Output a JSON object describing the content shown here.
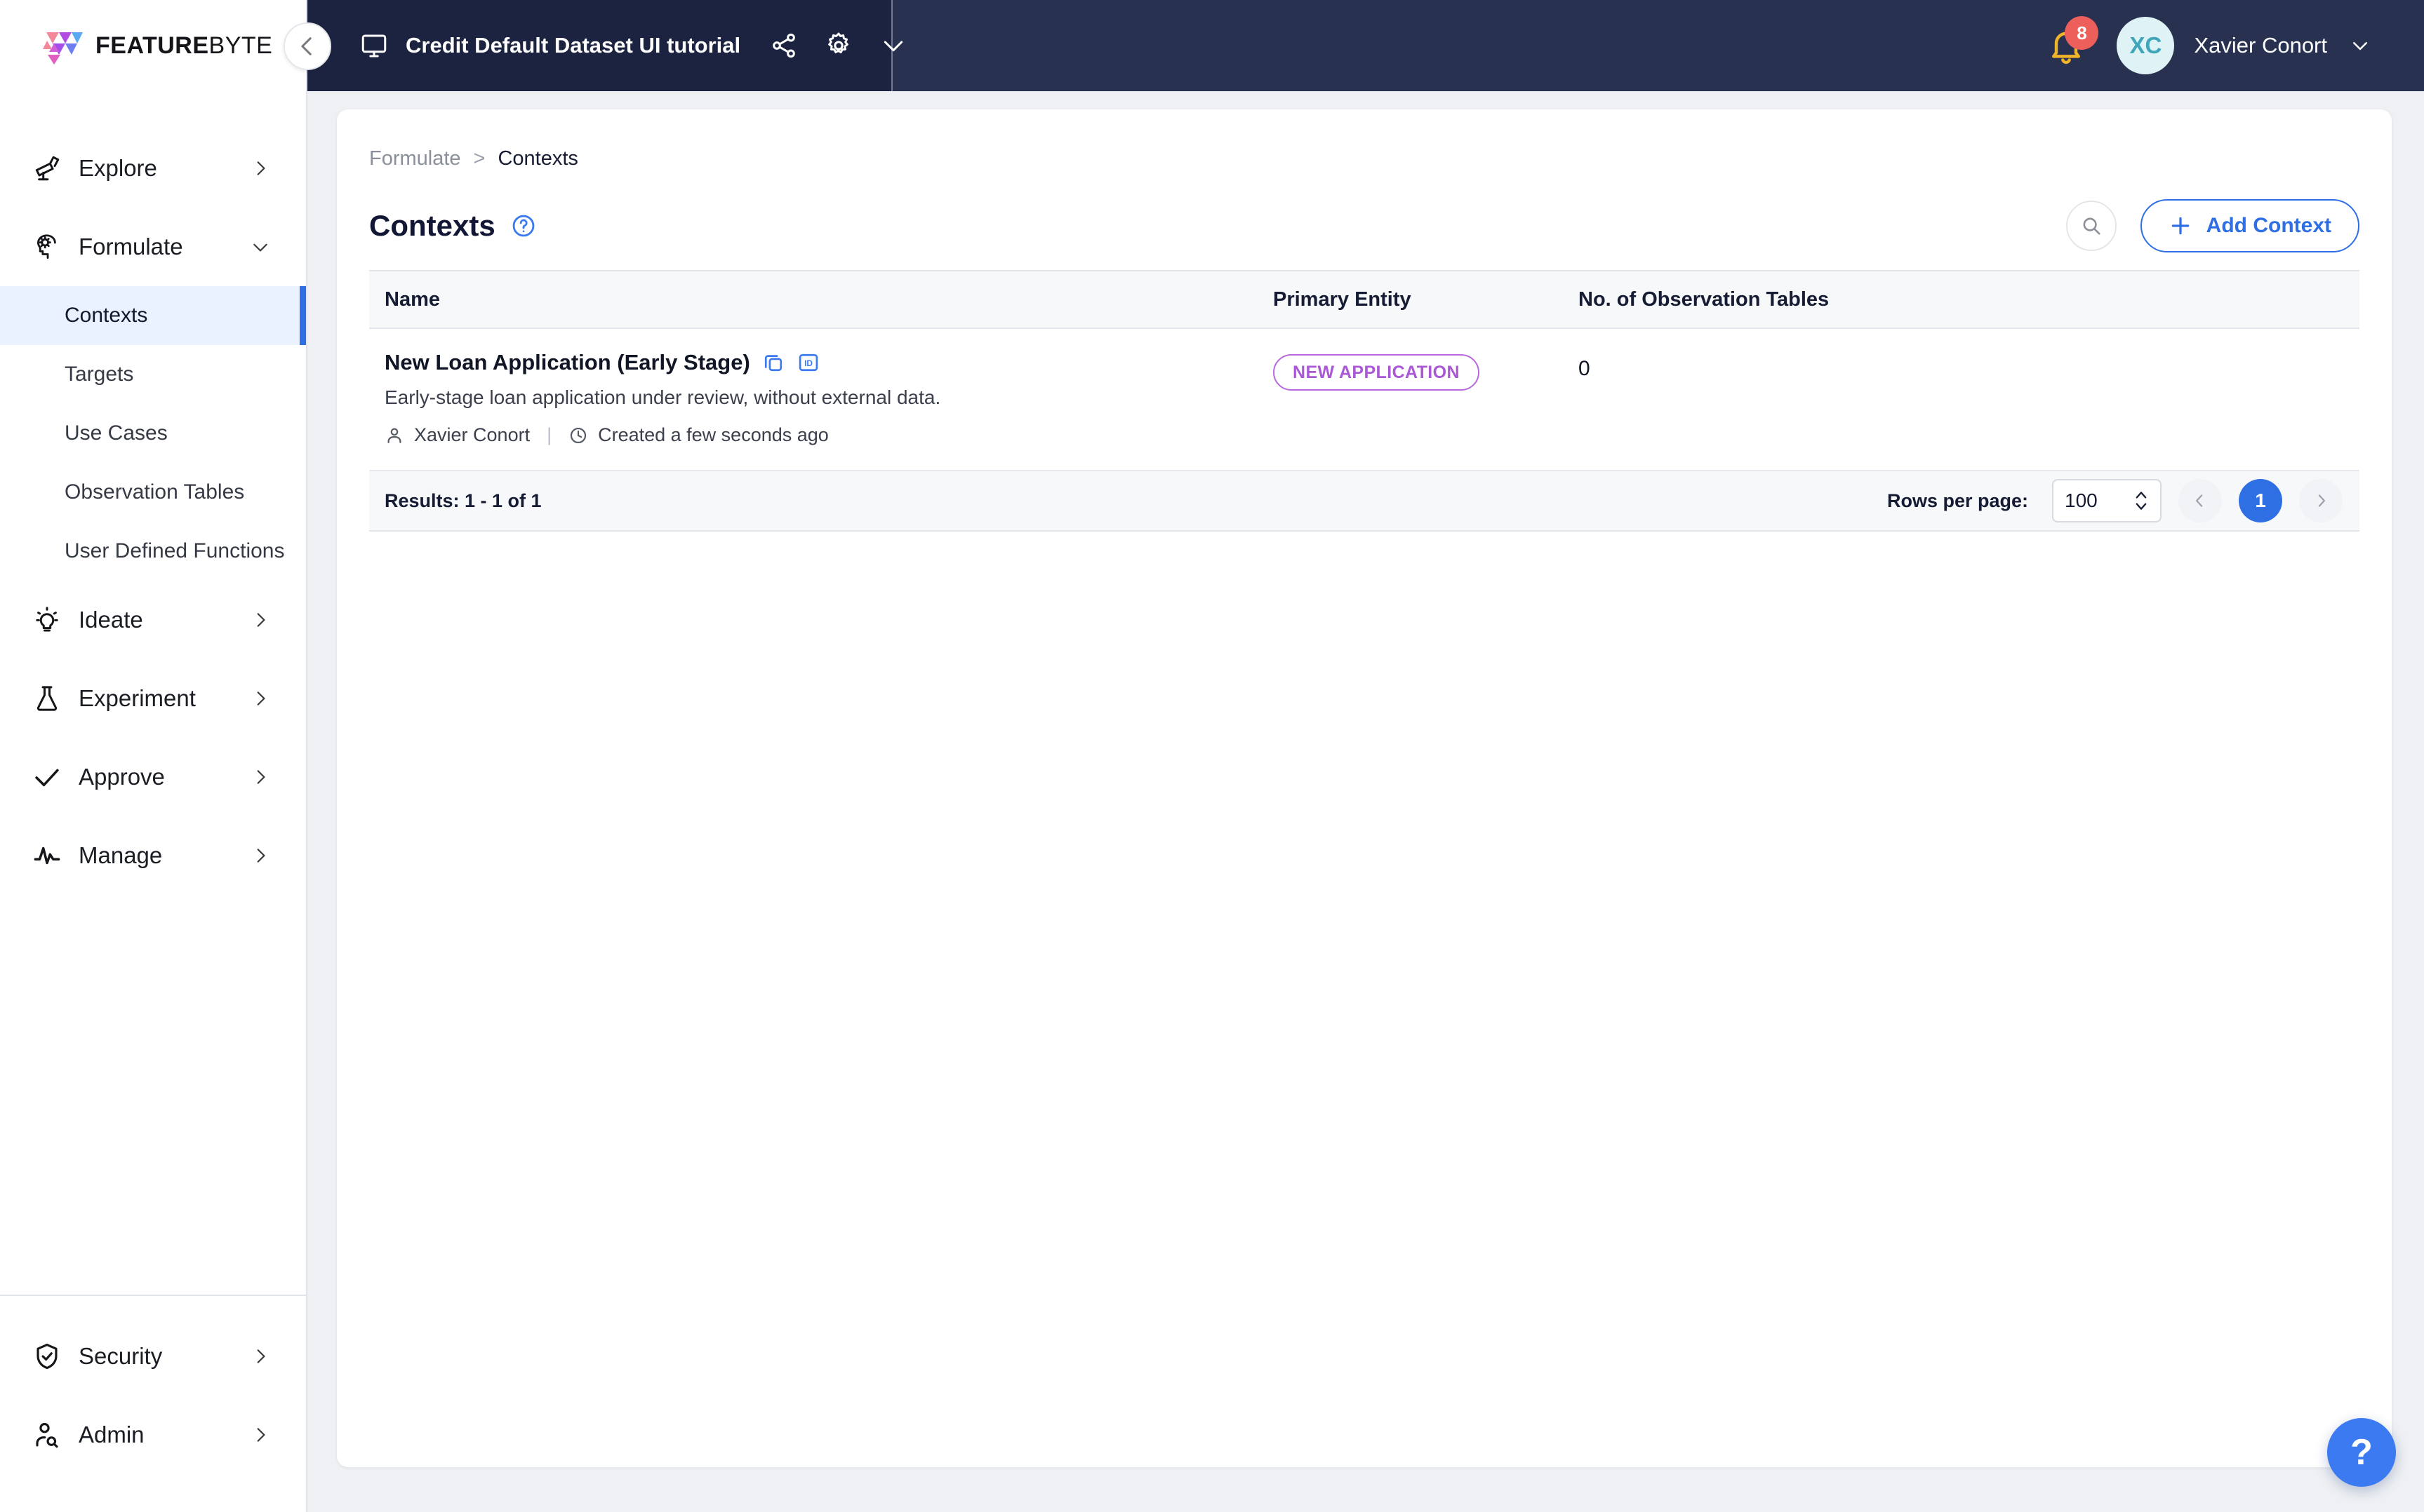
{
  "brand": {
    "name_bold": "FEATURE",
    "name_light": "BYTE",
    "logo_colors": [
      "#f2889a",
      "#b14ce0",
      "#6f7ef0",
      "#59a9f0",
      "#e05fc0"
    ]
  },
  "header": {
    "project_title": "Credit Default Dataset UI tutorial",
    "project_icon": "monitor-icon",
    "share_icon": "share-icon",
    "settings_icon": "gear-icon",
    "chevron_icon": "chevron-down-icon",
    "notifications": {
      "icon": "bell-icon",
      "count": "8",
      "badge_color": "#ec5f5b"
    },
    "user": {
      "initials": "XC",
      "name": "Xavier Conort",
      "avatar_bg": "#dff2f5",
      "avatar_fg": "#3ea6b8"
    },
    "collapse_icon": "chevron-left-icon",
    "bar_color": "#293150",
    "project_tab_color": "#1c2340"
  },
  "sidebar": {
    "groups": [
      {
        "label": "Explore",
        "icon": "telescope-icon",
        "state": "collapsed",
        "chevron": "chevron-right-icon"
      },
      {
        "label": "Formulate",
        "icon": "brain-gear-icon",
        "state": "expanded",
        "chevron": "chevron-down-icon"
      },
      {
        "label": "Ideate",
        "icon": "lightbulb-icon",
        "state": "collapsed",
        "chevron": "chevron-right-icon"
      },
      {
        "label": "Experiment",
        "icon": "flask-icon",
        "state": "collapsed",
        "chevron": "chevron-right-icon"
      },
      {
        "label": "Approve",
        "icon": "check-icon",
        "state": "collapsed",
        "chevron": "chevron-right-icon"
      },
      {
        "label": "Manage",
        "icon": "pulse-icon",
        "state": "collapsed",
        "chevron": "chevron-right-icon"
      }
    ],
    "formulate_items": [
      {
        "label": "Contexts",
        "active": true
      },
      {
        "label": "Targets",
        "active": false
      },
      {
        "label": "Use Cases",
        "active": false
      },
      {
        "label": "Observation Tables",
        "active": false
      },
      {
        "label": "User Defined Functions",
        "active": false
      }
    ],
    "bottom": [
      {
        "label": "Security",
        "icon": "shield-check-icon",
        "chevron": "chevron-right-icon"
      },
      {
        "label": "Admin",
        "icon": "user-search-icon",
        "chevron": "chevron-right-icon"
      }
    ],
    "active_accent": "#2f6fe4",
    "active_bg": "#e9f2fe"
  },
  "main": {
    "breadcrumb": {
      "parent": "Formulate",
      "separator": ">",
      "current": "Contexts"
    },
    "page_title": "Contexts",
    "help_icon": "question-circle-icon",
    "search_icon": "search-icon",
    "add_button": {
      "label": "Add Context",
      "icon": "plus-icon",
      "accent": "#2f6fe4"
    },
    "table": {
      "columns": [
        "Name",
        "Primary Entity",
        "No. of Observation Tables"
      ],
      "rows": [
        {
          "name": "New Loan Application (Early Stage)",
          "copy_icon": "copy-icon",
          "id_icon": "id-badge-icon",
          "description": "Early-stage loan application under review, without external data.",
          "author_icon": "user-icon",
          "author": "Xavier Conort",
          "meta_separator": "|",
          "time_icon": "clock-icon",
          "created": "Created a few seconds ago",
          "primary_entity": "NEW APPLICATION",
          "entity_color": "#aa58d6",
          "observation_tables": "0"
        }
      ]
    },
    "footer": {
      "results": "Results: 1 - 1 of 1",
      "rows_per_page_label": "Rows per page:",
      "rows_per_page_value": "100",
      "prev_icon": "chevron-left-icon",
      "next_icon": "chevron-right-icon",
      "current_page": "1"
    },
    "help_fab": {
      "label": "?",
      "color": "#3b7af0"
    }
  }
}
